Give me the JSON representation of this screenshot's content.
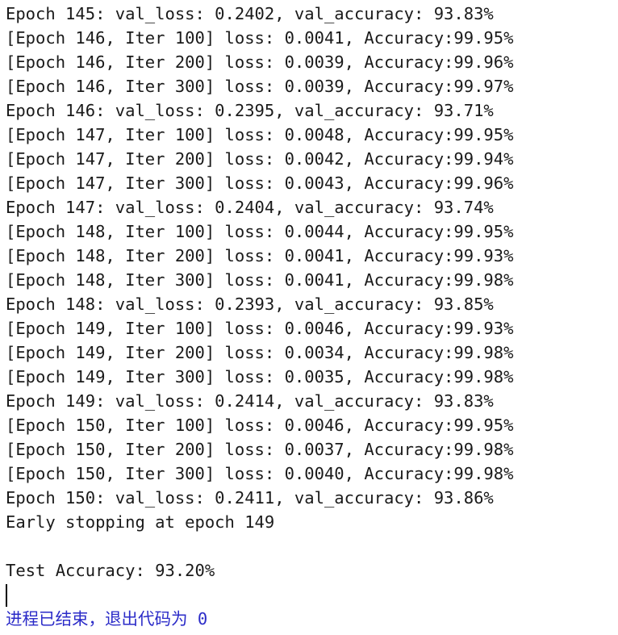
{
  "console": {
    "lines": [
      "Epoch 145: val_loss: 0.2402, val_accuracy: 93.83%",
      "[Epoch 146, Iter 100] loss: 0.0041, Accuracy:99.95%",
      "[Epoch 146, Iter 200] loss: 0.0039, Accuracy:99.96%",
      "[Epoch 146, Iter 300] loss: 0.0039, Accuracy:99.97%",
      "Epoch 146: val_loss: 0.2395, val_accuracy: 93.71%",
      "[Epoch 147, Iter 100] loss: 0.0048, Accuracy:99.95%",
      "[Epoch 147, Iter 200] loss: 0.0042, Accuracy:99.94%",
      "[Epoch 147, Iter 300] loss: 0.0043, Accuracy:99.96%",
      "Epoch 147: val_loss: 0.2404, val_accuracy: 93.74%",
      "[Epoch 148, Iter 100] loss: 0.0044, Accuracy:99.95%",
      "[Epoch 148, Iter 200] loss: 0.0041, Accuracy:99.93%",
      "[Epoch 148, Iter 300] loss: 0.0041, Accuracy:99.98%",
      "Epoch 148: val_loss: 0.2393, val_accuracy: 93.85%",
      "[Epoch 149, Iter 100] loss: 0.0046, Accuracy:99.93%",
      "[Epoch 149, Iter 200] loss: 0.0034, Accuracy:99.98%",
      "[Epoch 149, Iter 300] loss: 0.0035, Accuracy:99.98%",
      "Epoch 149: val_loss: 0.2414, val_accuracy: 93.83%",
      "[Epoch 150, Iter 100] loss: 0.0046, Accuracy:99.95%",
      "[Epoch 150, Iter 200] loss: 0.0037, Accuracy:99.98%",
      "[Epoch 150, Iter 300] loss: 0.0040, Accuracy:99.98%",
      "Epoch 150: val_loss: 0.2411, val_accuracy: 93.86%",
      "Early stopping at epoch 149"
    ],
    "test_result": "Test Accuracy: 93.20%",
    "exit_message": "进程已结束，退出代码为 0",
    "colors": {
      "text": "#1a1a1a",
      "exit_message": "#2b2bc8",
      "background": "#ffffff"
    }
  }
}
